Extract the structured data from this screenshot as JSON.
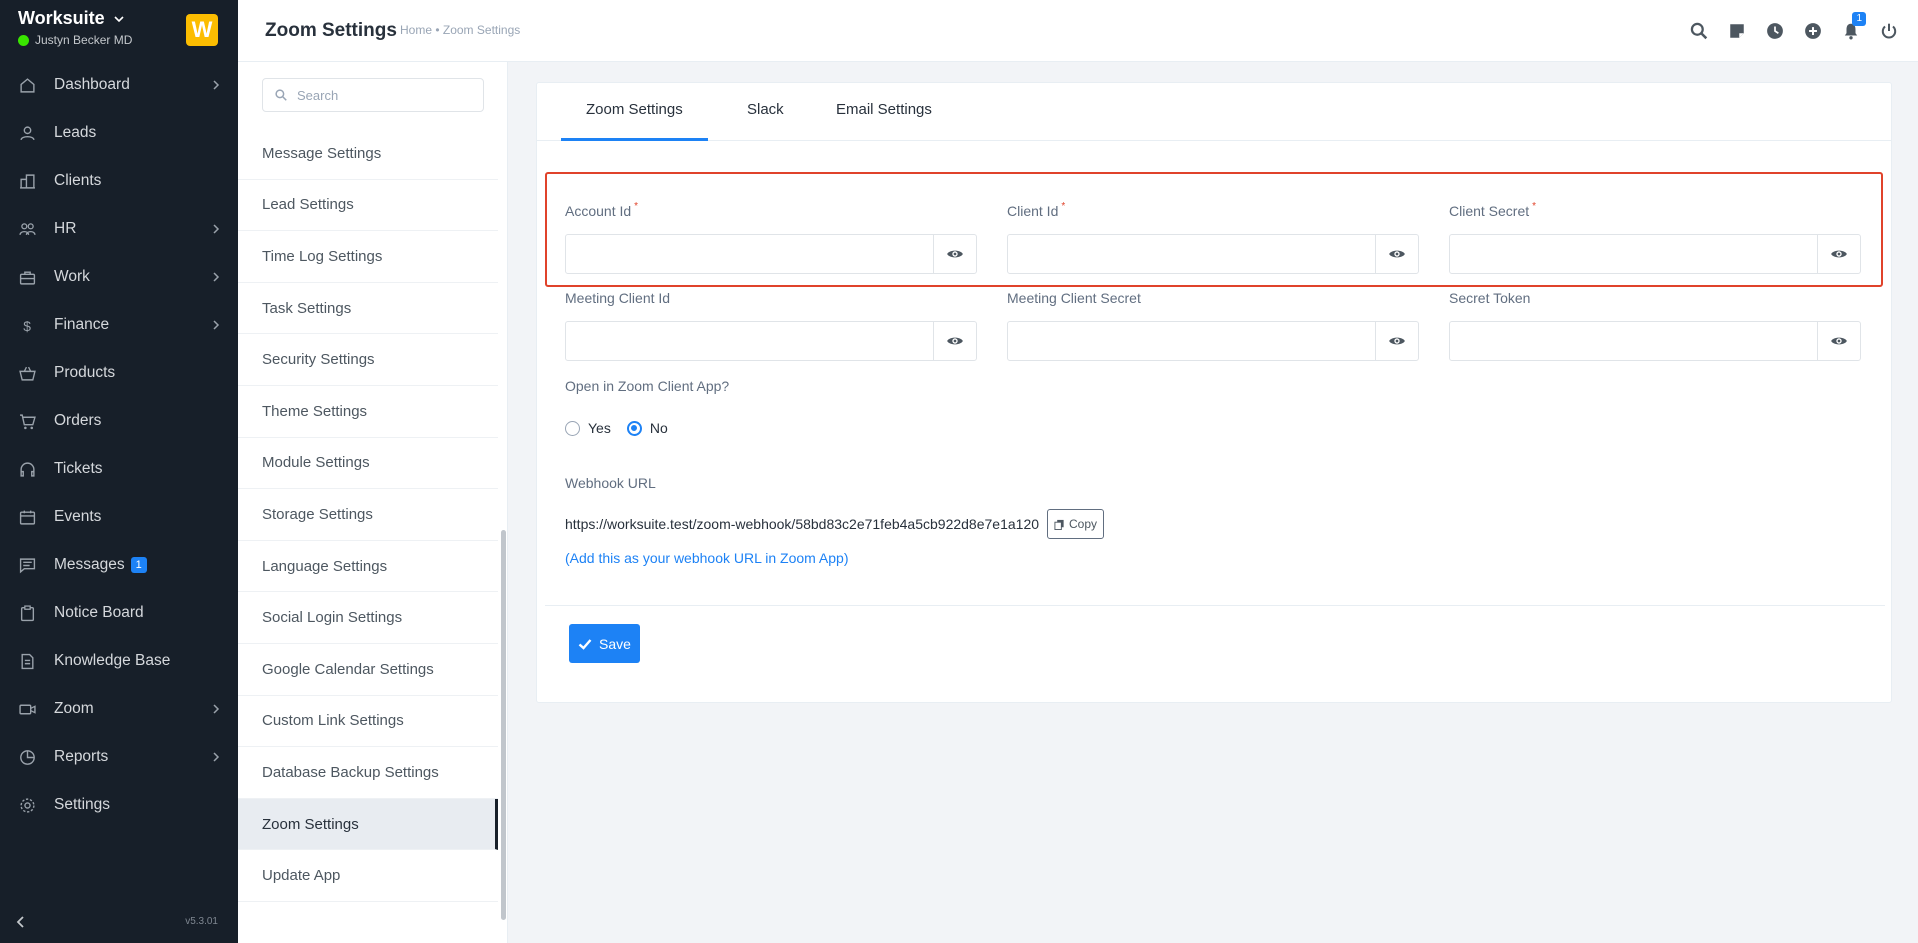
{
  "app": {
    "company": "Worksuite",
    "user": "Justyn Becker MD",
    "logo_letter": "W",
    "version": "v5.3.01"
  },
  "sidebar": {
    "items": [
      {
        "label": "Dashboard",
        "icon": "house-icon",
        "has_children": true
      },
      {
        "label": "Leads",
        "icon": "person-icon",
        "has_children": false
      },
      {
        "label": "Clients",
        "icon": "building-icon",
        "has_children": false
      },
      {
        "label": "HR",
        "icon": "people-icon",
        "has_children": true
      },
      {
        "label": "Work",
        "icon": "briefcase-icon",
        "has_children": true
      },
      {
        "label": "Finance",
        "icon": "dollar-icon",
        "has_children": true
      },
      {
        "label": "Products",
        "icon": "basket-icon",
        "has_children": false
      },
      {
        "label": "Orders",
        "icon": "cart-icon",
        "has_children": false
      },
      {
        "label": "Tickets",
        "icon": "headset-icon",
        "has_children": false
      },
      {
        "label": "Events",
        "icon": "calendar-icon",
        "has_children": false
      },
      {
        "label": "Messages",
        "icon": "chat-icon",
        "has_children": false,
        "badge": "1"
      },
      {
        "label": "Notice Board",
        "icon": "clipboard-icon",
        "has_children": false
      },
      {
        "label": "Knowledge Base",
        "icon": "document-icon",
        "has_children": false
      },
      {
        "label": "Zoom",
        "icon": "camera-icon",
        "has_children": true
      },
      {
        "label": "Reports",
        "icon": "pie-chart-icon",
        "has_children": true
      },
      {
        "label": "Settings",
        "icon": "gear-icon",
        "has_children": false
      }
    ]
  },
  "header": {
    "title": "Zoom Settings",
    "breadcrumb": "Home • Zoom Settings",
    "notification_count": "1"
  },
  "settings_nav": {
    "search_placeholder": "Search",
    "items": [
      "Message Settings",
      "Lead Settings",
      "Time Log Settings",
      "Task Settings",
      "Security Settings",
      "Theme Settings",
      "Module Settings",
      "Storage Settings",
      "Language Settings",
      "Social Login Settings",
      "Google Calendar Settings",
      "Custom Link Settings",
      "Database Backup Settings",
      "Zoom Settings",
      "Update App"
    ],
    "active_item": "Zoom Settings"
  },
  "tabs": [
    {
      "label": "Zoom Settings",
      "active": true
    },
    {
      "label": "Slack",
      "active": false
    },
    {
      "label": "Email Settings",
      "active": false
    }
  ],
  "form": {
    "account_id": {
      "label": "Account Id",
      "value": "",
      "required": true
    },
    "client_id": {
      "label": "Client Id",
      "value": "",
      "required": true
    },
    "client_secret": {
      "label": "Client Secret",
      "value": "",
      "required": true
    },
    "meeting_client_id": {
      "label": "Meeting Client Id",
      "value": ""
    },
    "meeting_client_secret": {
      "label": "Meeting Client Secret",
      "value": ""
    },
    "secret_token": {
      "label": "Secret Token",
      "value": ""
    },
    "open_in_app": {
      "label": "Open in Zoom Client App?",
      "options": [
        "Yes",
        "No"
      ],
      "selected": "No"
    },
    "webhook": {
      "label": "Webhook URL",
      "url": "https://worksuite.test/zoom-webhook/58bd83c2e71feb4a5cb922d8e7e1a120",
      "copy_label": "Copy",
      "hint": "(Add this as your webhook URL in Zoom App)"
    },
    "save_label": "Save"
  },
  "colors": {
    "sidebar_bg": "#171f29",
    "accent": "#1d82f5",
    "highlight_border": "#e0432b",
    "logo_bg": "#fcbd01",
    "online": "#39e500"
  }
}
